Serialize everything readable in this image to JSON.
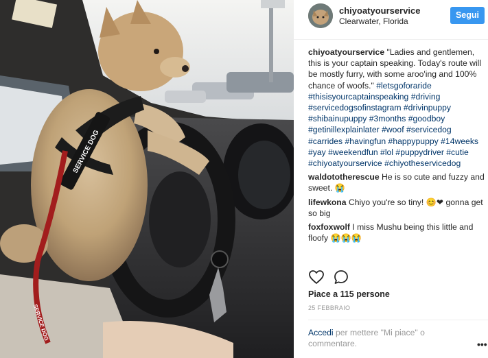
{
  "post": {
    "username": "chiyoatyourservice",
    "location": "Clearwater, Florida",
    "follow_label": "Segui",
    "harness_text": "SERVICE DOG",
    "leash_text": "SERVICE DOG"
  },
  "caption": {
    "user": "chiyoatyourservice",
    "text": "\"Ladies and gentlemen, this is your captain speaking. Today's route will be mostly furry, with some aroo'ing and 100% chance of woofs.\"",
    "hashtags": [
      "#letsgoforaride",
      "#thisisyourcaptainspeaking",
      "#driving",
      "#servicedogsofinstagram",
      "#drivinpuppy",
      "#shibainupuppy",
      "#3months",
      "#goodboy",
      "#getinillexplainlater",
      "#woof",
      "#servicedog",
      "#carrides",
      "#havingfun",
      "#happypuppy",
      "#14weeks",
      "#yay",
      "#weekendfun",
      "#lol",
      "#puppydriver",
      "#cutie",
      "#chiyoatyourservice",
      "#chiyotheservicedog"
    ]
  },
  "comments": [
    {
      "user": "waldototherescue",
      "text": "He is so cute and fuzzy and sweet. 😭"
    },
    {
      "user": "lifewkona",
      "text": "Chiyo you're so tiny! 😊❤ gonna get so big"
    },
    {
      "user": "foxfoxwolf",
      "text": "I miss Mushu being this little and floofy 😭😭😭"
    }
  ],
  "icons": {
    "like": "heart-outline-icon",
    "comment": "speech-bubble-icon",
    "more": "ellipsis-icon"
  },
  "likes_text": "Piace a 115 persone",
  "date_text": "25 FEBBRAIO",
  "login": {
    "link": "Accedi",
    "text": " per mettere \"Mi piace\" o commentare."
  },
  "more_label": "•••",
  "colors": {
    "follow_button": "#3897f0",
    "hashtag": "#003569",
    "muted": "#999999"
  }
}
